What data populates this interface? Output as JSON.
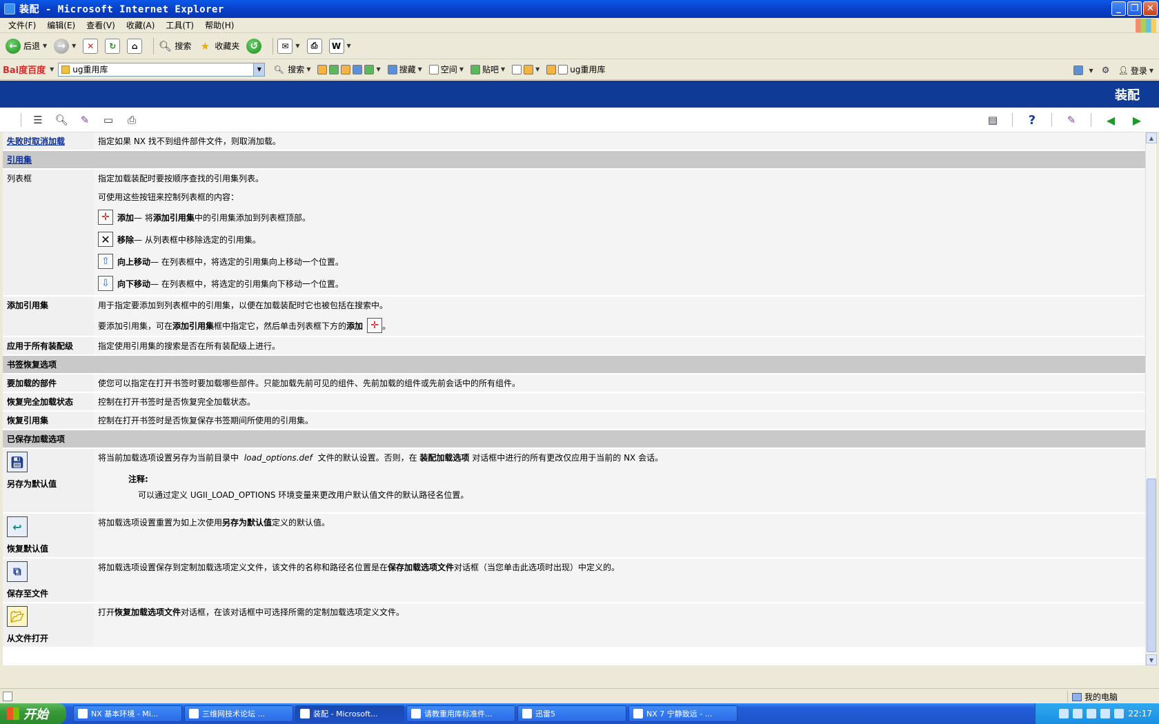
{
  "window": {
    "title": "装配 - Microsoft Internet Explorer"
  },
  "menu": [
    "文件(F)",
    "编辑(E)",
    "查看(V)",
    "收藏(A)",
    "工具(T)",
    "帮助(H)"
  ],
  "toolbar": {
    "back_label": "后退",
    "search_label": "搜索",
    "favorites_label": "收藏夹"
  },
  "baidu": {
    "logo_text": "Bai度百度",
    "query": "ug重用库",
    "search_label": "搜索",
    "collect_label": "搜藏",
    "space_label": "空间",
    "tieba_label": "贴吧",
    "ugreuse_label": "ug重用库",
    "login_label": "登录"
  },
  "help": {
    "header_title": "装配",
    "rows": {
      "fail_cancel": {
        "label": "失败时取消加载",
        "text": "指定如果 NX 找不到组件部件文件，则取消加载。"
      },
      "refset_section": "引用集",
      "listbox": {
        "label": "列表框",
        "p1": "指定加载装配时要按顺序查找的引用集列表。",
        "p2": "可使用这些按钮来控制列表框的内容：",
        "add_b": "添加",
        "add_t1": " — 将",
        "add_b2": "添加引用集",
        "add_t2": "中的引用集添加到列表框顶部。",
        "remove_b": "移除",
        "remove_t": " — 从列表框中移除选定的引用集。",
        "up_b": "向上移动",
        "up_t": " — 在列表框中，将选定的引用集向上移动一个位置。",
        "down_b": "向下移动",
        "down_t": " — 在列表框中，将选定的引用集向下移动一个位置。"
      },
      "add_refset": {
        "label": "添加引用集",
        "p1": "用于指定要添加到列表框中的引用集，以便在加载装配时它也被包括在搜索中。",
        "p2a": "要添加引用集，可在",
        "p2b": "添加引用集",
        "p2c": "框中指定它，然后单击列表框下方的",
        "p2d": "添加",
        "p2e": "。"
      },
      "apply_all": {
        "label": "应用于所有装配级",
        "text": "指定使用引用集的搜索是否在所有装配级上进行。"
      },
      "bookmark_section": "书签恢复选项",
      "parts_to_load": {
        "label": "要加载的部件",
        "text": "使您可以指定在打开书签时要加载哪些部件。只能加载先前可见的组件、先前加载的组件或先前会话中的所有组件。"
      },
      "restore_full": {
        "label": "恢复完全加载状态",
        "text": "控制在打开书签时是否恢复完全加载状态。"
      },
      "restore_refset": {
        "label": "恢复引用集",
        "text": "控制在打开书签时是否恢复保存书签期间所使用的引用集。"
      },
      "saved_section": "已保存加载选项",
      "save_default": {
        "label": "另存为默认值",
        "t1": "将当前加载选项设置另存为当前目录中",
        "file": "load_options.def",
        "t2": "文件的默认设置。否则，在",
        "b1": "装配加载选项",
        "t3": "对话框中进行的所有更改仅应用于当前的 NX 会话。",
        "note_title": "注释:",
        "note_body": "可以通过定义 UGII_LOAD_OPTIONS 环境变量来更改用户默认值文件的默认路径名位置。"
      },
      "restore_default": {
        "label": "恢复默认值",
        "t1": "将加载选项设置重置为如上次使用",
        "b1": "另存为默认值",
        "t2": "定义的默认值。"
      },
      "save_file": {
        "label": "保存至文件",
        "t1": "将加载选项设置保存到定制加载选项定义文件，该文件的名称和路径名位置是在",
        "b1": "保存加载选项文件",
        "t2": "对话框（当您单击此选项时出现）中定义的。"
      },
      "open_file": {
        "label": "从文件打开",
        "t1": "打开",
        "b1": "恢复加载选项文件",
        "t2": "对话框，在该对话框中可选择所需的定制加载选项定义文件。"
      }
    }
  },
  "status": {
    "zone": "我的电脑"
  },
  "taskbar": {
    "start": "开始",
    "tasks": [
      "NX 基本环境 - Mi...",
      "三维网技术论坛 ...",
      "装配 - Microsoft...",
      "请教重用库标准件...",
      "迅雷5",
      "NX 7 宁静致远 - ..."
    ],
    "clock": "22:17"
  },
  "colors": {
    "help_header": "#0f3a96",
    "section_bg": "#c9c9c9",
    "title_bar": "#0a58e8"
  }
}
